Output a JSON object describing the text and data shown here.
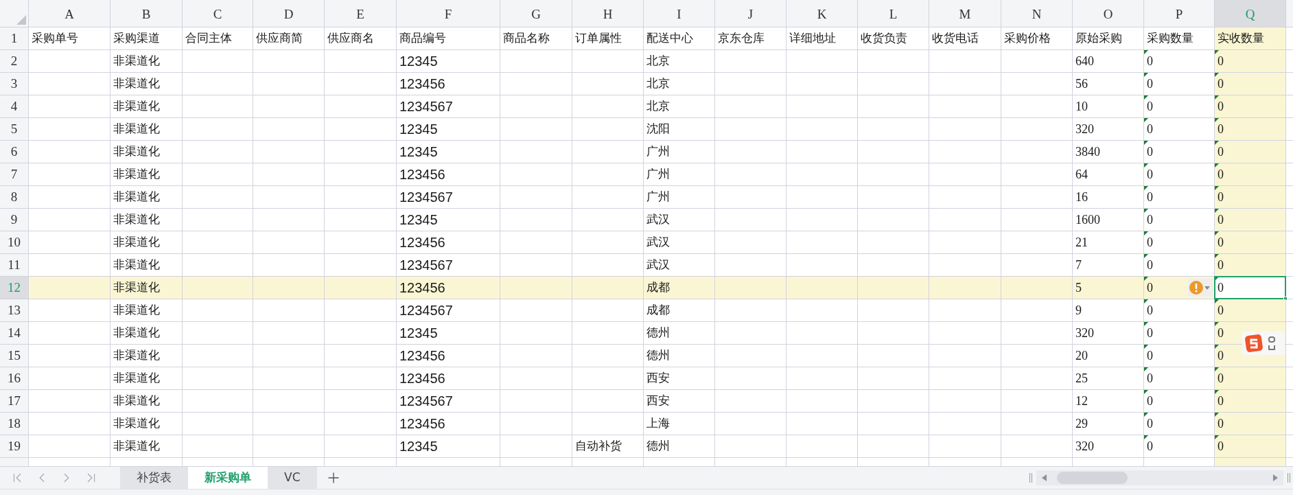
{
  "sheet": {
    "columns": [
      {
        "letter": "A",
        "selected": false,
        "text_numbers": false
      },
      {
        "letter": "B",
        "selected": false,
        "text_numbers": false
      },
      {
        "letter": "C",
        "selected": false,
        "text_numbers": false
      },
      {
        "letter": "D",
        "selected": false,
        "text_numbers": false
      },
      {
        "letter": "E",
        "selected": false,
        "text_numbers": false
      },
      {
        "letter": "F",
        "selected": false,
        "text_numbers": false
      },
      {
        "letter": "G",
        "selected": false,
        "text_numbers": false
      },
      {
        "letter": "H",
        "selected": false,
        "text_numbers": false
      },
      {
        "letter": "I",
        "selected": false,
        "text_numbers": false
      },
      {
        "letter": "J",
        "selected": false,
        "text_numbers": false
      },
      {
        "letter": "K",
        "selected": false,
        "text_numbers": false
      },
      {
        "letter": "L",
        "selected": false,
        "text_numbers": false
      },
      {
        "letter": "M",
        "selected": false,
        "text_numbers": false
      },
      {
        "letter": "N",
        "selected": false,
        "text_numbers": false
      },
      {
        "letter": "O",
        "selected": false,
        "text_numbers": false
      },
      {
        "letter": "P",
        "selected": false,
        "text_numbers": true
      },
      {
        "letter": "Q",
        "selected": true,
        "text_numbers": true
      }
    ],
    "header_row": {
      "number": "1",
      "cells": [
        "采购单号",
        "采购渠道",
        "合同主体",
        "供应商简",
        "供应商名",
        "商品编号",
        "商品名称",
        "订单属性",
        "配送中心",
        "京东仓库",
        "详细地址",
        "收货负责",
        "收货电话",
        "采购价格",
        "原始采购",
        "采购数量",
        "实收数量"
      ]
    },
    "rows": [
      {
        "number": "2",
        "selected": false,
        "warning": false,
        "purchase_channel": "非渠道化",
        "product_code": "12345",
        "distribution_center": "北京",
        "original_quantity": "640",
        "purchase_quantity": "0",
        "received_quantity": "0"
      },
      {
        "number": "3",
        "selected": false,
        "warning": false,
        "purchase_channel": "非渠道化",
        "product_code": "123456",
        "distribution_center": "北京",
        "original_quantity": "56",
        "purchase_quantity": "0",
        "received_quantity": "0"
      },
      {
        "number": "4",
        "selected": false,
        "warning": false,
        "purchase_channel": "非渠道化",
        "product_code": "1234567",
        "distribution_center": "北京",
        "original_quantity": "10",
        "purchase_quantity": "0",
        "received_quantity": "0"
      },
      {
        "number": "5",
        "selected": false,
        "warning": false,
        "purchase_channel": "非渠道化",
        "product_code": "12345",
        "distribution_center": "沈阳",
        "original_quantity": "320",
        "purchase_quantity": "0",
        "received_quantity": "0"
      },
      {
        "number": "6",
        "selected": false,
        "warning": false,
        "purchase_channel": "非渠道化",
        "product_code": "12345",
        "distribution_center": "广州",
        "original_quantity": "3840",
        "purchase_quantity": "0",
        "received_quantity": "0"
      },
      {
        "number": "7",
        "selected": false,
        "warning": false,
        "purchase_channel": "非渠道化",
        "product_code": "123456",
        "distribution_center": "广州",
        "original_quantity": "64",
        "purchase_quantity": "0",
        "received_quantity": "0"
      },
      {
        "number": "8",
        "selected": false,
        "warning": false,
        "purchase_channel": "非渠道化",
        "product_code": "1234567",
        "distribution_center": "广州",
        "original_quantity": "16",
        "purchase_quantity": "0",
        "received_quantity": "0"
      },
      {
        "number": "9",
        "selected": false,
        "warning": false,
        "purchase_channel": "非渠道化",
        "product_code": "12345",
        "distribution_center": "武汉",
        "original_quantity": "1600",
        "purchase_quantity": "0",
        "received_quantity": "0"
      },
      {
        "number": "10",
        "selected": false,
        "warning": false,
        "purchase_channel": "非渠道化",
        "product_code": "123456",
        "distribution_center": "武汉",
        "original_quantity": "21",
        "purchase_quantity": "0",
        "received_quantity": "0"
      },
      {
        "number": "11",
        "selected": false,
        "warning": false,
        "purchase_channel": "非渠道化",
        "product_code": "1234567",
        "distribution_center": "武汉",
        "original_quantity": "7",
        "purchase_quantity": "0",
        "received_quantity": "0"
      },
      {
        "number": "12",
        "selected": true,
        "warning": true,
        "purchase_channel": "非渠道化",
        "product_code": "123456",
        "distribution_center": "成都",
        "original_quantity": "5",
        "purchase_quantity": "0",
        "received_quantity": "0"
      },
      {
        "number": "13",
        "selected": false,
        "warning": false,
        "purchase_channel": "非渠道化",
        "product_code": "1234567",
        "distribution_center": "成都",
        "original_quantity": "9",
        "purchase_quantity": "0",
        "received_quantity": "0"
      },
      {
        "number": "14",
        "selected": false,
        "warning": false,
        "purchase_channel": "非渠道化",
        "product_code": "12345",
        "distribution_center": "德州",
        "original_quantity": "320",
        "purchase_quantity": "0",
        "received_quantity": "0"
      },
      {
        "number": "15",
        "selected": false,
        "warning": false,
        "purchase_channel": "非渠道化",
        "product_code": "123456",
        "distribution_center": "德州",
        "original_quantity": "20",
        "purchase_quantity": "0",
        "received_quantity": "0"
      },
      {
        "number": "16",
        "selected": false,
        "warning": false,
        "purchase_channel": "非渠道化",
        "product_code": "123456",
        "distribution_center": "西安",
        "original_quantity": "25",
        "purchase_quantity": "0",
        "received_quantity": "0"
      },
      {
        "number": "17",
        "selected": false,
        "warning": false,
        "purchase_channel": "非渠道化",
        "product_code": "1234567",
        "distribution_center": "西安",
        "original_quantity": "12",
        "purchase_quantity": "0",
        "received_quantity": "0"
      },
      {
        "number": "18",
        "selected": false,
        "warning": false,
        "purchase_channel": "非渠道化",
        "product_code": "123456",
        "distribution_center": "上海",
        "original_quantity": "29",
        "purchase_quantity": "0",
        "received_quantity": "0"
      },
      {
        "number": "19",
        "selected": false,
        "warning": false,
        "purchase_channel": "非渠道化",
        "product_code": "12345",
        "order_attribute": "自动补货",
        "distribution_center": "德州",
        "original_quantity": "320",
        "purchase_quantity": "0",
        "received_quantity": "0"
      }
    ]
  },
  "sheet_tabs": [
    {
      "label": "补货表",
      "selected": false
    },
    {
      "label": "新采购单",
      "selected": true
    },
    {
      "label": "VC",
      "selected": false
    }
  ]
}
